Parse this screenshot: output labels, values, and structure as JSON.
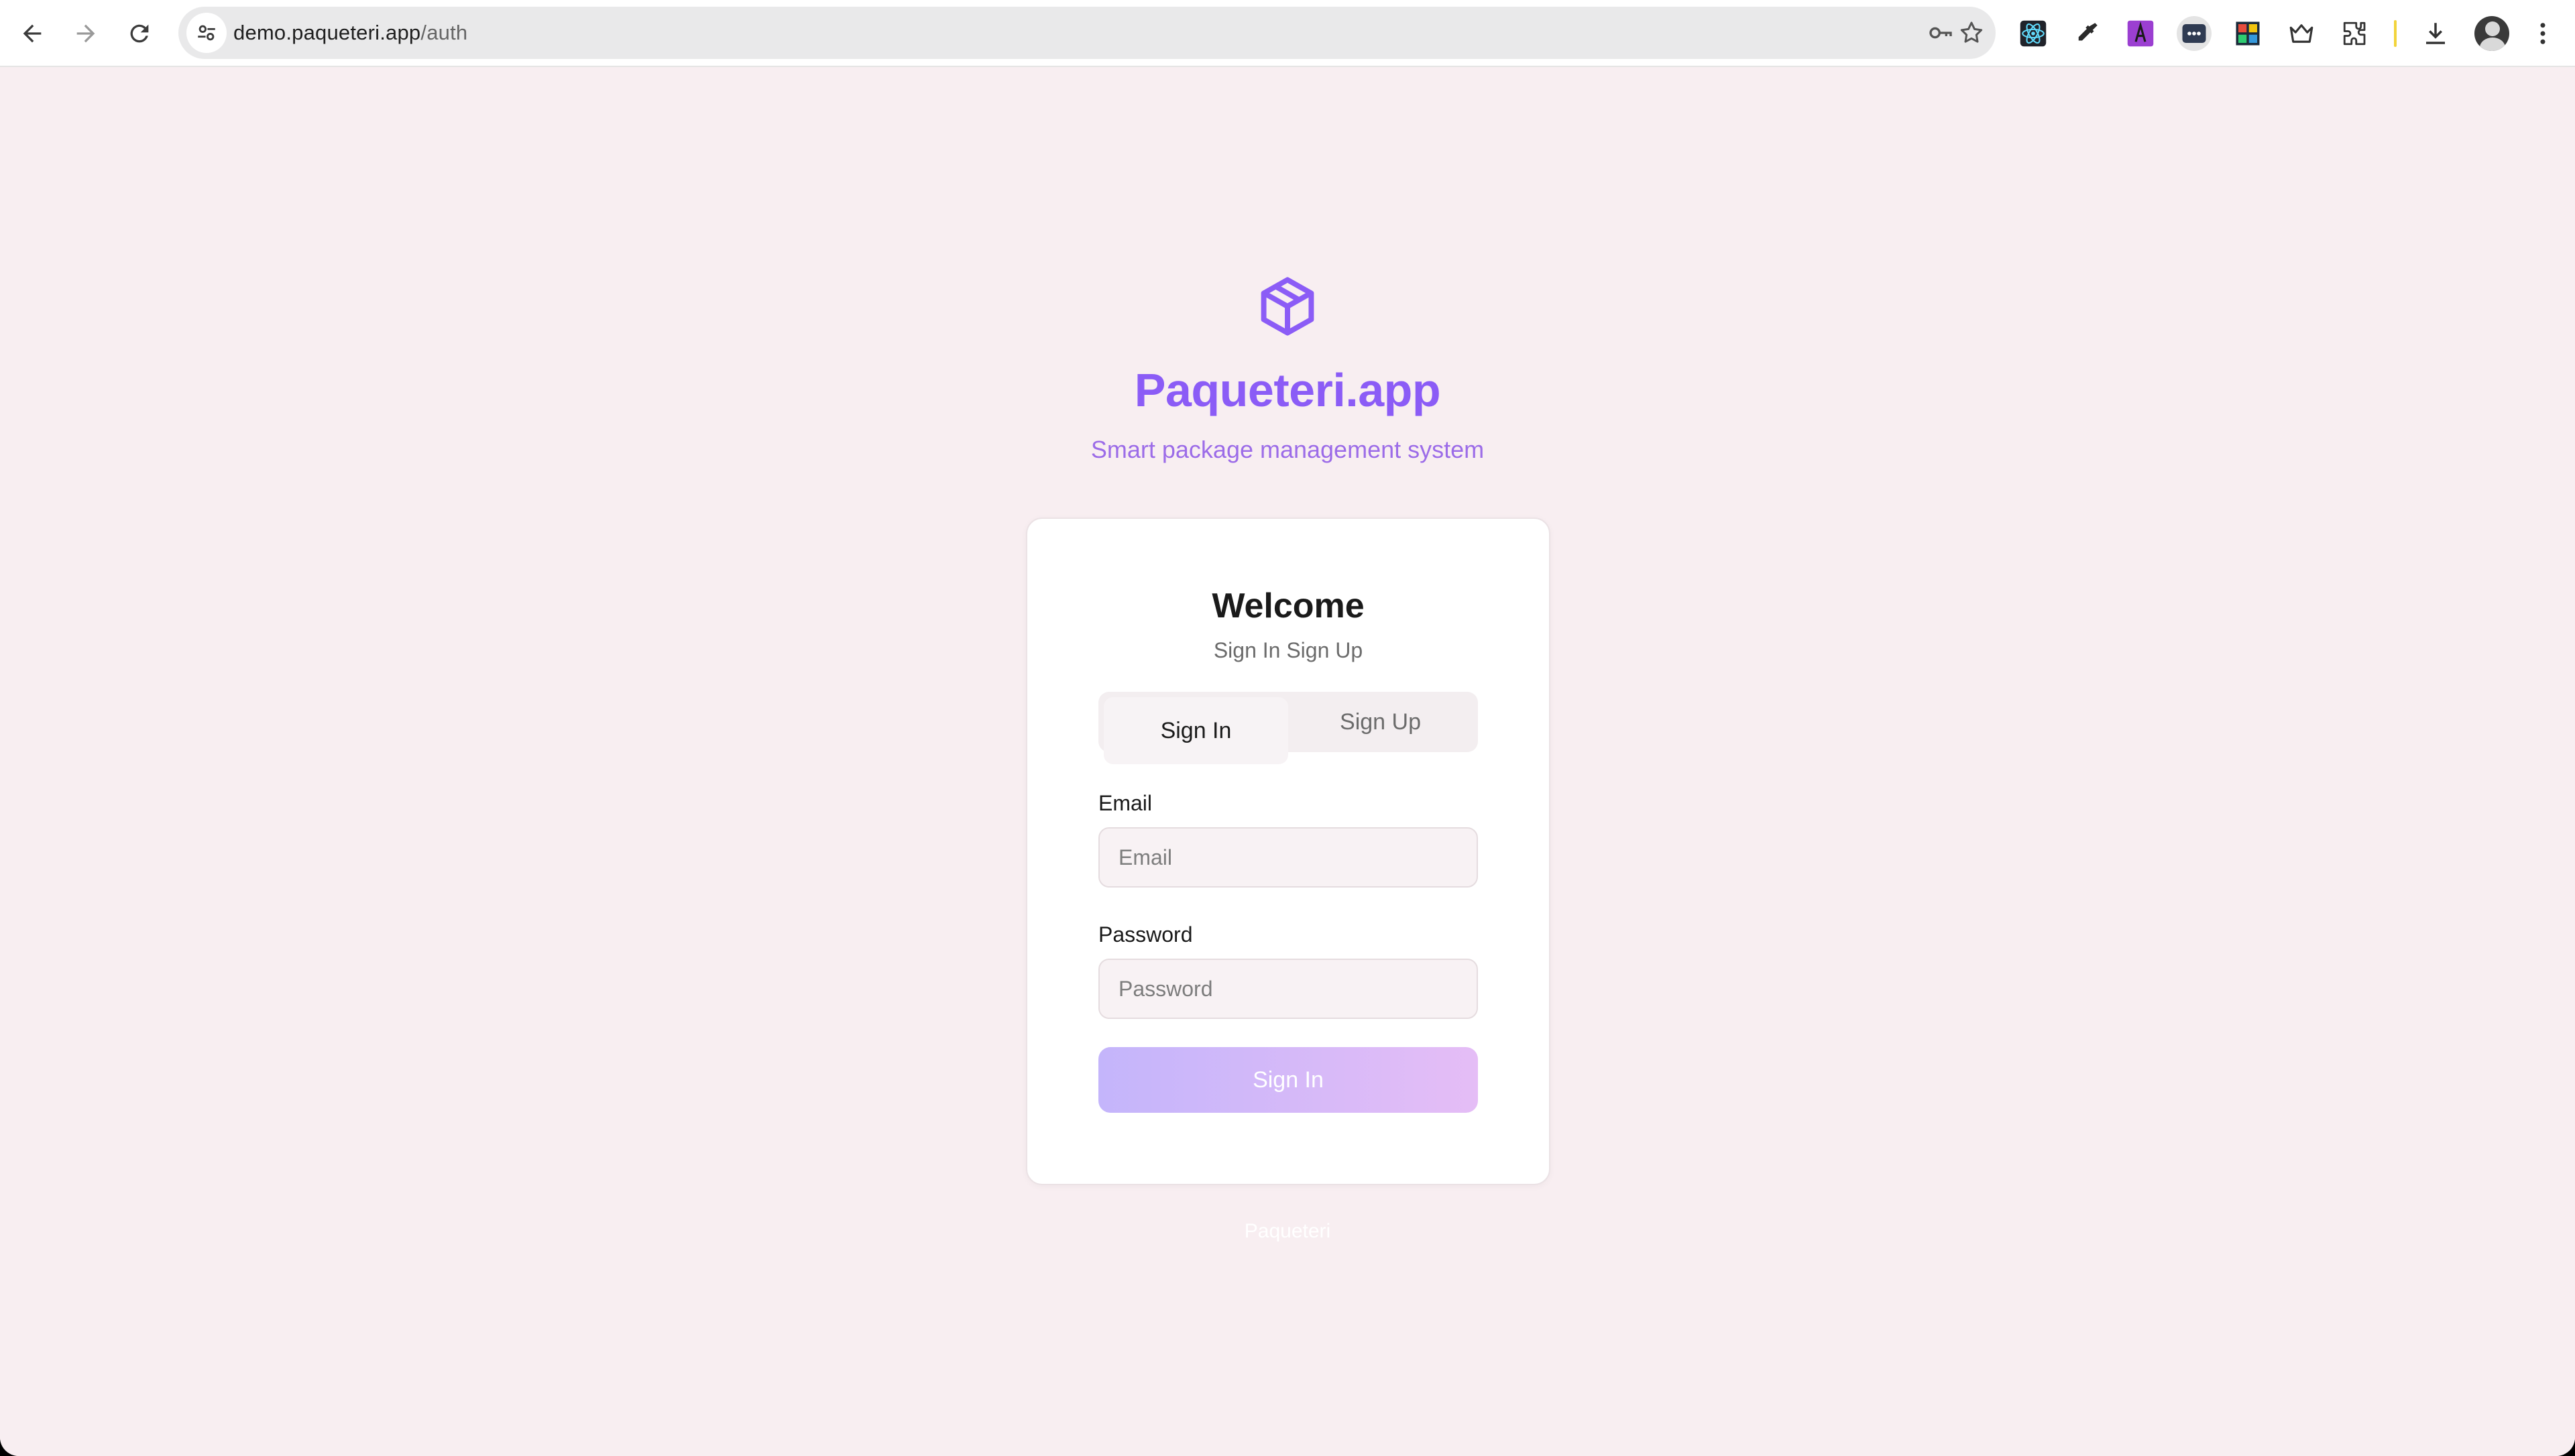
{
  "browser": {
    "url_host": "demo.paqueteri.app",
    "url_path": "/auth",
    "icons": {
      "back": "arrow-left-icon",
      "forward": "arrow-right-icon",
      "reload": "reload-icon",
      "site_info": "tune-icon",
      "password": "key-icon",
      "bookmark": "star-icon"
    },
    "extensions": [
      "react-devtools-icon",
      "eyedropper-icon",
      "font-icon",
      "dots-icon",
      "color-palette-icon",
      "crown-icon",
      "puzzle-icon"
    ],
    "download_icon": "download-icon",
    "menu_icon": "more-vert-icon"
  },
  "app": {
    "logo_icon": "package-icon",
    "name": "Paqueteri.app",
    "tagline": "Smart package management system",
    "brand_color": "#8b5cf6"
  },
  "auth_card": {
    "title": "Welcome",
    "description": "Sign In Sign Up",
    "tabs": [
      {
        "label": "Sign In",
        "active": true
      },
      {
        "label": "Sign Up",
        "active": false
      }
    ],
    "email": {
      "label": "Email",
      "placeholder": "Email",
      "value": ""
    },
    "password": {
      "label": "Password",
      "placeholder": "Password",
      "value": ""
    },
    "submit_label": "Sign In"
  },
  "footer": {
    "note": "Paqueteri"
  }
}
